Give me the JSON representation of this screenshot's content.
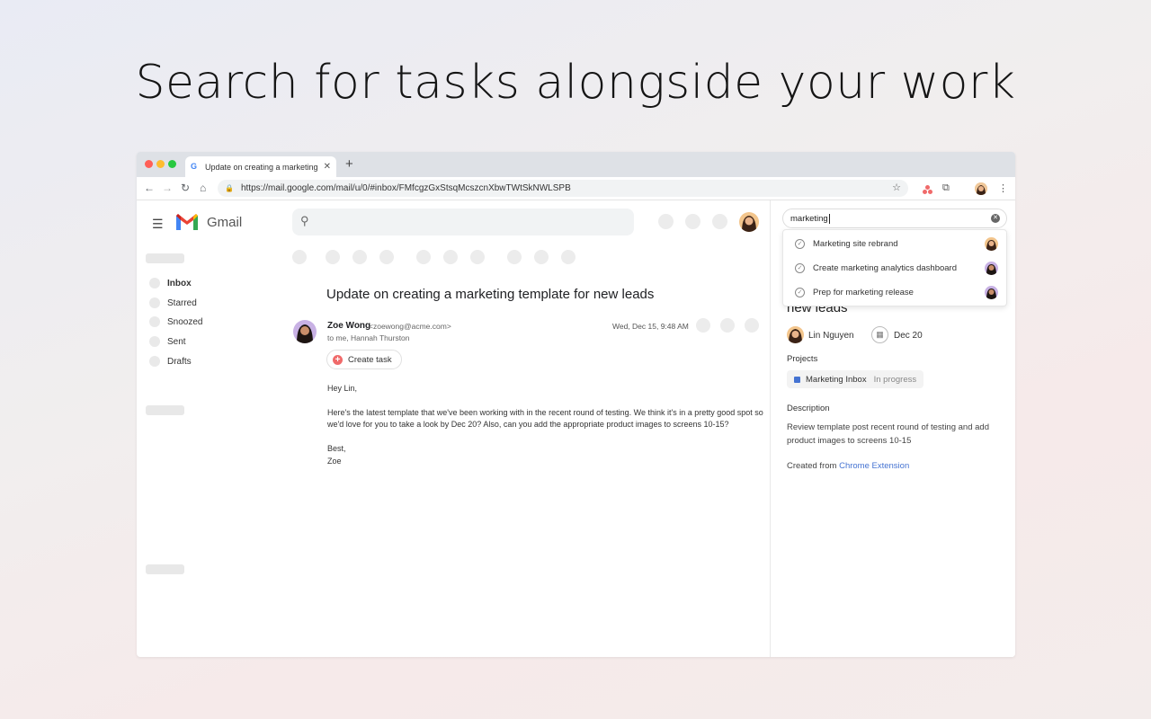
{
  "headline": "Search for tasks alongside your work",
  "browser": {
    "tab_title": "Update on creating a marketing t",
    "url": "https://mail.google.com/mail/u/0/#inbox/FMfcgzGxStsqMcszcnXbwTWtSkNWLSPB",
    "colors": {
      "close": "#ff5f57",
      "minimize": "#febc2e",
      "maximize": "#28c840"
    }
  },
  "gmail": {
    "app_name": "Gmail",
    "nav": [
      "Inbox",
      "Starred",
      "Snoozed",
      "Sent",
      "Drafts"
    ],
    "email": {
      "subject": "Update on creating a marketing template for new leads",
      "sender_name": "Zoe Wong",
      "sender_email": "<zoewong@acme.com>",
      "recipients": "to me, Hannah Thurston",
      "date": "Wed, Dec 15, 9:48 AM",
      "create_task_label": "Create task",
      "greeting": "Hey Lin,",
      "body_line1": "Here's the latest template that we've been working with in the recent round of testing. We think it's in a pretty good spot so",
      "body_line2": "we'd love for you to take a look by Dec 20? Also, can you add the appropriate product images to screens 10-15?",
      "signoff": "Best,",
      "signature": "Zoe"
    }
  },
  "asana": {
    "search_value": "marketing",
    "results": [
      "Marketing site rebrand",
      "Create marketing analytics dashboard",
      "Prep for marketing release"
    ],
    "task": {
      "title_visible": "new leads",
      "assignee": "Lin Nguyen",
      "due_date": "Dec 20",
      "projects_label": "Projects",
      "project_name": "Marketing Inbox",
      "project_status": "In progress",
      "description_label": "Description",
      "description": "Review template post recent round of testing and add product images to screens 10-15",
      "created_from_prefix": "Created from",
      "created_from_link": "Chrome Extension"
    }
  }
}
